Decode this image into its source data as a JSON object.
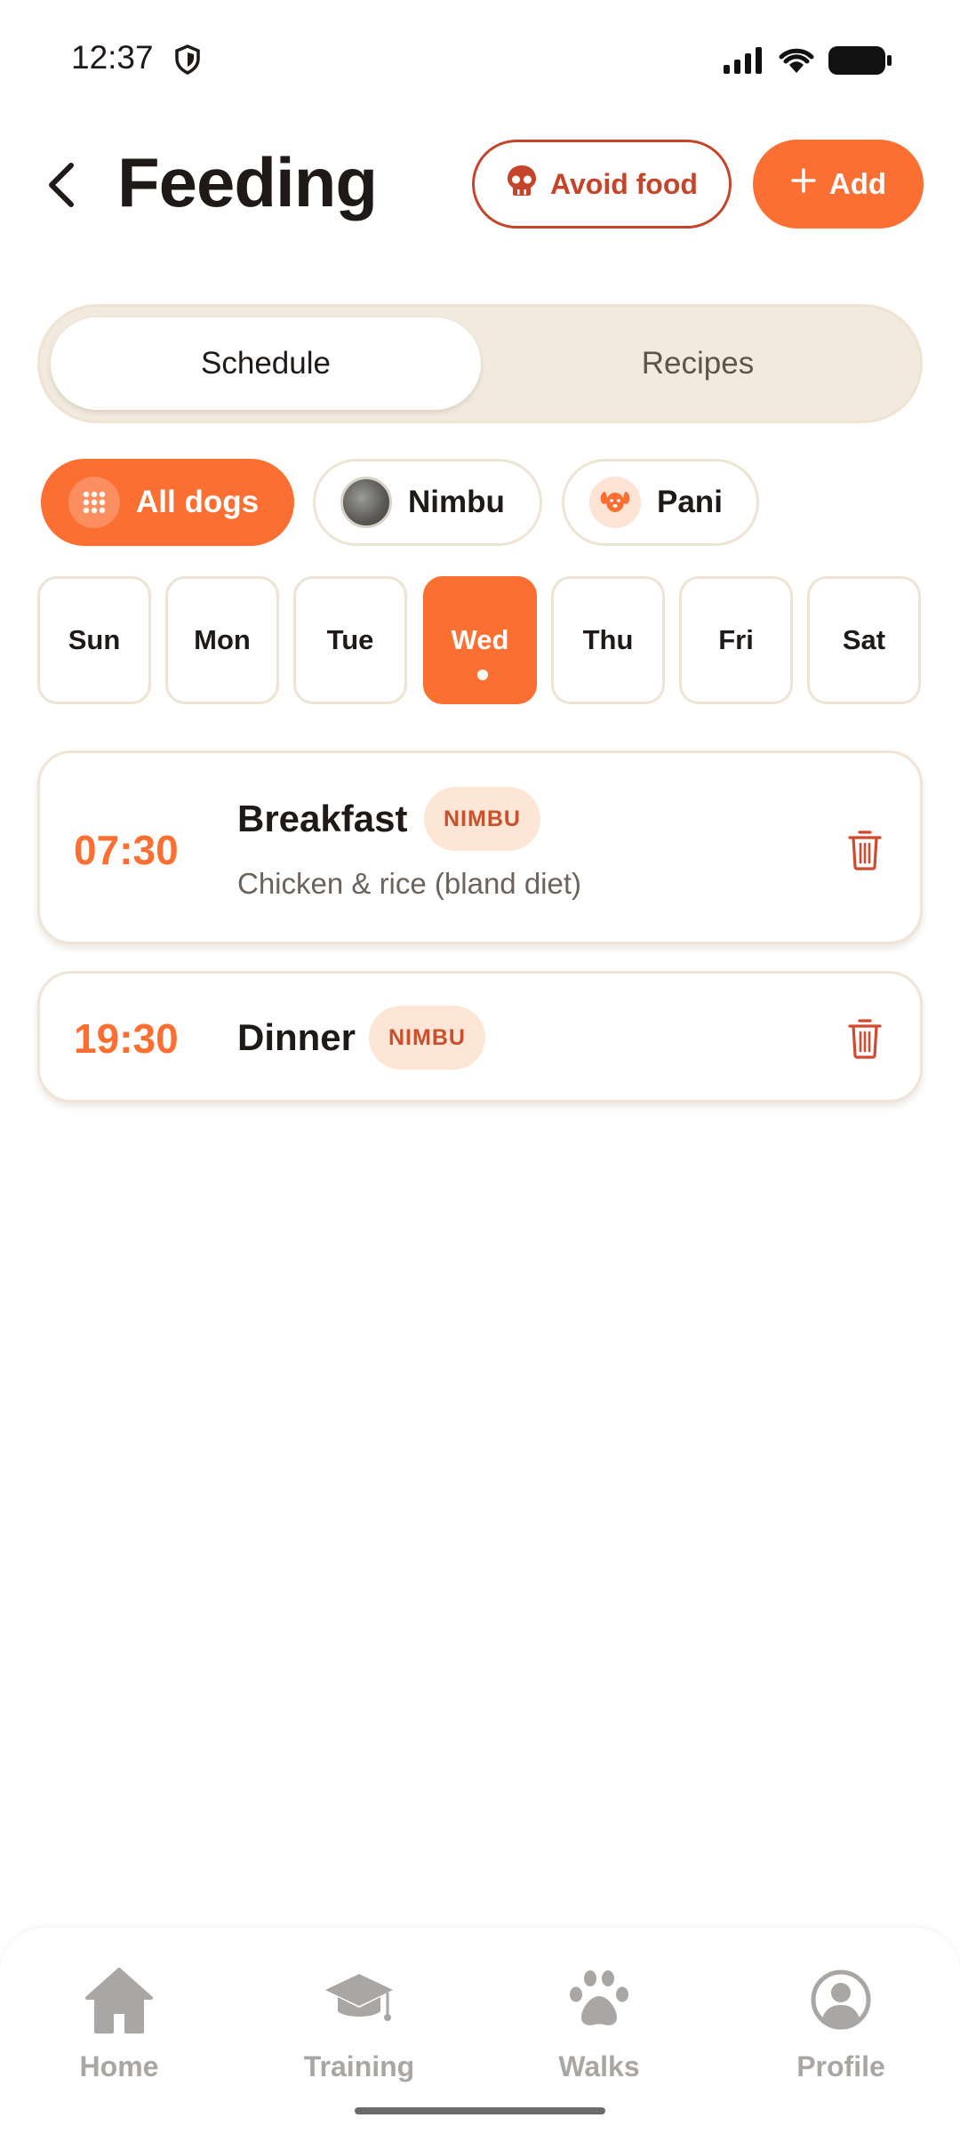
{
  "status_bar": {
    "time": "12:37",
    "icons": [
      "shield-icon",
      "signal-icon",
      "wifi-icon",
      "battery-icon"
    ]
  },
  "header": {
    "title": "Feeding",
    "avoid_food_label": "Avoid food",
    "add_label": "Add"
  },
  "tabs": [
    {
      "label": "Schedule",
      "active": true
    },
    {
      "label": "Recipes",
      "active": false
    }
  ],
  "dog_filters": [
    {
      "label": "All dogs",
      "active": true
    },
    {
      "label": "Nimbu",
      "active": false
    },
    {
      "label": "Pani",
      "active": false
    }
  ],
  "days": [
    {
      "label": "Sun"
    },
    {
      "label": "Mon"
    },
    {
      "label": "Tue"
    },
    {
      "label": "Wed",
      "active": true
    },
    {
      "label": "Thu"
    },
    {
      "label": "Fri"
    },
    {
      "label": "Sat"
    }
  ],
  "meals": [
    {
      "time": "07:30",
      "name": "Breakfast",
      "dog": "NIMBU",
      "description": "Chicken & rice (bland diet)"
    },
    {
      "time": "19:30",
      "name": "Dinner",
      "dog": "NIMBU",
      "description": ""
    }
  ],
  "bottom_nav": [
    {
      "label": "Home",
      "icon": "home-icon"
    },
    {
      "label": "Training",
      "icon": "graduation-cap-icon"
    },
    {
      "label": "Walks",
      "icon": "paw-icon"
    },
    {
      "label": "Profile",
      "icon": "profile-icon"
    }
  ],
  "colors": {
    "accent": "#fb6f33",
    "danger": "#c5452a",
    "muted": "#a9a6a3",
    "segment_bg": "#f2eadf"
  }
}
